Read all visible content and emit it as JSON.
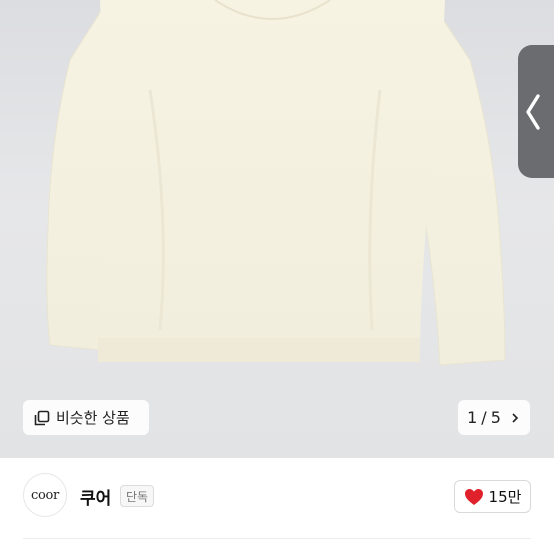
{
  "gallery": {
    "similar_label": "비슷한 상품",
    "current": "1",
    "separator": "/",
    "total": "5"
  },
  "store": {
    "logo_text": "coor",
    "name": "쿠어",
    "badge": "단독"
  },
  "like": {
    "count": "15만",
    "color": "#e0202a"
  }
}
